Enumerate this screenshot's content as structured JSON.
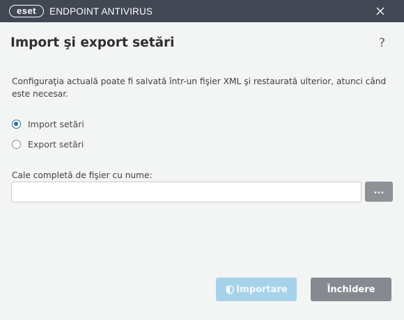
{
  "app": {
    "logo_text": "eset",
    "product_name": "ENDPOINT ANTIVIRUS"
  },
  "dialog": {
    "title": "Import şi export setări",
    "help": "?",
    "description": "Configuraţia actuală poate fi salvată într-un fişier XML şi restaurată ulterior, atunci când este necesar.",
    "options": [
      {
        "label": "Import setări",
        "selected": true
      },
      {
        "label": "Export setări",
        "selected": false
      }
    ],
    "path_label": "Cale completă de fişier cu nume:",
    "path_value": "",
    "browse_label": "...",
    "import_label": "Importare",
    "close_label": "Închidere"
  },
  "colors": {
    "titlebar": "#414753",
    "background": "#f3f4f4",
    "radio_accent": "#2c6e9e",
    "import_button_disabled": "#a6d3ea",
    "close_button": "#868a90"
  },
  "icons": {
    "close": "close-icon",
    "help": "help-icon",
    "import": "shield-icon"
  }
}
